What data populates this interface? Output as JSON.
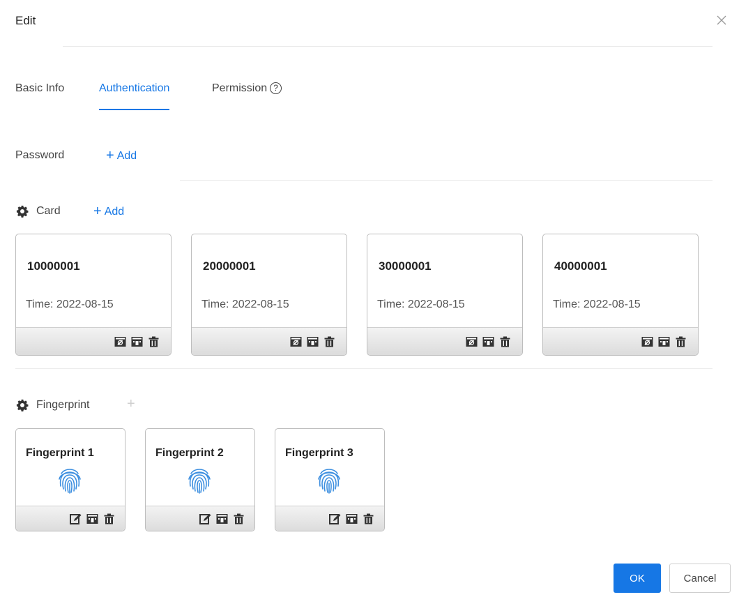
{
  "dialog": {
    "title": "Edit"
  },
  "tabs": [
    {
      "label": "Basic Info",
      "active": false
    },
    {
      "label": "Authentication",
      "active": true
    },
    {
      "label": "Permission",
      "active": false,
      "help_icon": "question-circle-icon"
    }
  ],
  "password": {
    "label": "Password",
    "add_label": "Add"
  },
  "card_section": {
    "label": "Card",
    "add_label": "Add",
    "icon": "gear-icon"
  },
  "cards": [
    {
      "number": "10000001",
      "time_label": "Time:",
      "time": "2022-08-15"
    },
    {
      "number": "20000001",
      "time_label": "Time:",
      "time": "2022-08-15"
    },
    {
      "number": "30000001",
      "time_label": "Time:",
      "time": "2022-08-15"
    },
    {
      "number": "40000001",
      "time_label": "Time:",
      "time": "2022-08-15"
    }
  ],
  "card_actions": [
    "report-lost-icon",
    "duress-card-icon",
    "delete-icon"
  ],
  "fingerprint_section": {
    "label": "Fingerprint",
    "add_label": "+",
    "icon": "gear-icon",
    "add_disabled": true
  },
  "fingerprints": [
    {
      "title": "Fingerprint 1"
    },
    {
      "title": "Fingerprint 2"
    },
    {
      "title": "Fingerprint 3"
    }
  ],
  "fingerprint_actions": [
    "edit-icon",
    "duress-icon",
    "delete-icon"
  ],
  "footer": {
    "ok_label": "OK",
    "cancel_label": "Cancel"
  },
  "colors": {
    "accent": "#1677e5",
    "border": "#bdbdbd",
    "bar": "#dcdcdc"
  }
}
